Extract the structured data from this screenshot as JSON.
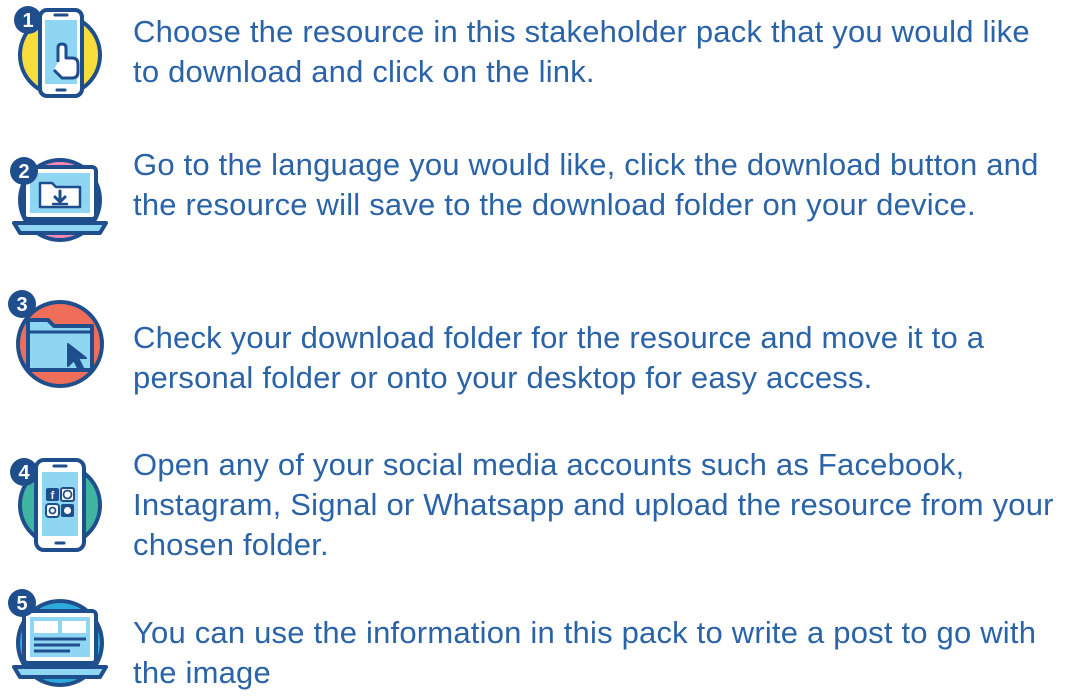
{
  "colors": {
    "text": "#2a63a8",
    "outline": "#1f4e8c",
    "badge": "#1f4e8c",
    "step1_circle": "#f7dc3c",
    "step2_circle": "#f08ab4",
    "step3_circle": "#ee6e5a",
    "step4_circle": "#3fb4a0",
    "step5_circle": "#2fa8dc",
    "screen": "#8fd6f3"
  },
  "steps": [
    {
      "number": "1",
      "icon": "phone-tap-icon",
      "text": "Choose the resource in this stakeholder pack that you would like to download and click on the link."
    },
    {
      "number": "2",
      "icon": "laptop-download-icon",
      "text": "Go to the language you would like, click the download button and the resource will save to the download folder on your device."
    },
    {
      "number": "3",
      "icon": "folder-cursor-icon",
      "text": "Check your download folder for the resource and move it to a personal folder or onto your desktop for easy access."
    },
    {
      "number": "4",
      "icon": "phone-social-apps-icon",
      "text": "Open any of your social media accounts such as Facebook, Instagram, Signal or Whatsapp and upload the resource from your chosen folder."
    },
    {
      "number": "5",
      "icon": "laptop-post-icon",
      "text": "You can use the information in this pack to write a post to go with the image"
    }
  ]
}
